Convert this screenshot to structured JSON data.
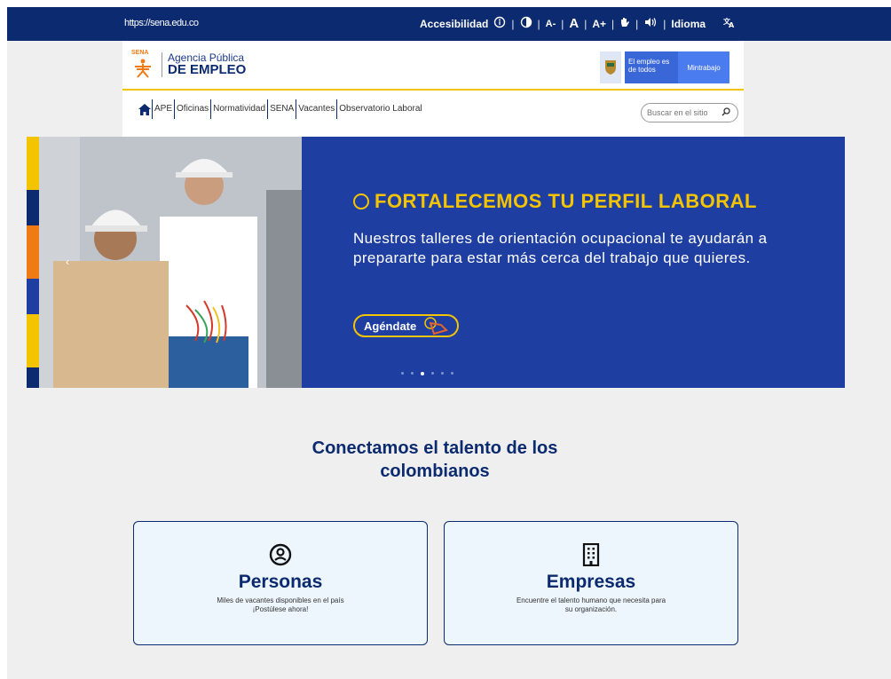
{
  "topbar": {
    "url": "https://sena.edu.co",
    "accessibility_label": "Accesibilidad",
    "language_label": "Idioma",
    "tools": [
      "⓪",
      "◐",
      "A-",
      "A",
      "A+",
      "✋",
      "🔊"
    ]
  },
  "header": {
    "logo_line1": "Agencia Pública",
    "logo_line2": "DE EMPLEO",
    "sena_label": "SENA",
    "gov_badge_1": "El empleo es de todos",
    "gov_badge_2": "Mintrabajo"
  },
  "nav": {
    "items": [
      "APE",
      "Oficinas",
      "Normatividad",
      "SENA",
      "Vacantes",
      "Observatorio Laboral"
    ]
  },
  "search": {
    "placeholder": "Buscar en el sitio"
  },
  "hero": {
    "title": "FORTALECEMOS TU PERFIL LABORAL",
    "body": "Nuestros talleres de orientación ocupacional te ayudarán a prepararte para estar más cerca del trabajo que quieres.",
    "cta": "Agéndate",
    "prev_arrow": "‹",
    "slides": 6,
    "active_slide": 3
  },
  "section": {
    "title": "Conectamos el talento de los colombianos"
  },
  "cards": {
    "personas": {
      "title": "Personas",
      "desc1": "Miles de vacantes disponibles en el país",
      "desc2": "¡Postúlese ahora!"
    },
    "empresas": {
      "title": "Empresas",
      "desc1": "Encuentre el talento humano que necesita para",
      "desc2": "su organización."
    }
  },
  "colors": {
    "brand_navy": "#0b2a6f",
    "hero_blue": "#1e3ea1",
    "accent_yellow": "#f5c400",
    "card_bg": "#edf6fd"
  }
}
